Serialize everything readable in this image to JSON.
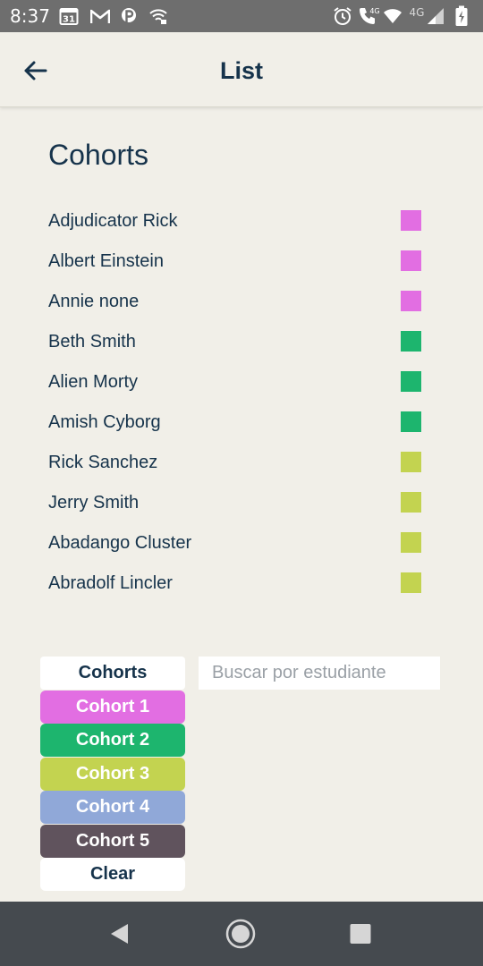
{
  "status_bar": {
    "time": "8:37",
    "calendar_day": "31",
    "left_icons": [
      "calendar-icon",
      "gmail-icon",
      "parking-icon",
      "wifi-hotspot-icon"
    ],
    "right_icons": [
      "alarm-icon",
      "wifi-calling-icon",
      "wifi-icon",
      "cell-signal-icon",
      "battery-icon"
    ],
    "network_label_1": "4G",
    "network_label_2": "4G"
  },
  "app_bar": {
    "title": "List",
    "back_icon": "arrow-left-icon"
  },
  "section_title": "Cohorts",
  "students": [
    {
      "name": "Adjudicator Rick",
      "color": "#e26ee2"
    },
    {
      "name": "Albert Einstein",
      "color": "#e26ee2"
    },
    {
      "name": "Annie none",
      "color": "#e26ee2"
    },
    {
      "name": "Beth Smith",
      "color": "#1db56e"
    },
    {
      "name": "Alien Morty",
      "color": "#1db56e"
    },
    {
      "name": "Amish Cyborg",
      "color": "#1db56e"
    },
    {
      "name": "Rick Sanchez",
      "color": "#c3d350"
    },
    {
      "name": "Jerry Smith",
      "color": "#c3d350"
    },
    {
      "name": "Abadango Cluster",
      "color": "#c3d350"
    },
    {
      "name": "Abradolf Lincler",
      "color": "#c3d350"
    }
  ],
  "cohort_filter": {
    "header": "Cohorts",
    "items": [
      {
        "label": "Cohort 1",
        "color": "#e26ee2"
      },
      {
        "label": "Cohort 2",
        "color": "#1db56e"
      },
      {
        "label": "Cohort 3",
        "color": "#c3d350"
      },
      {
        "label": "Cohort 4",
        "color": "#90a8d8"
      },
      {
        "label": "Cohort 5",
        "color": "#60535d"
      }
    ],
    "clear": "Clear"
  },
  "search": {
    "placeholder": "Buscar por estudiante",
    "value": ""
  },
  "nav_bar": {
    "icons": [
      "back-triangle-icon",
      "home-circle-icon",
      "recents-square-icon"
    ]
  }
}
